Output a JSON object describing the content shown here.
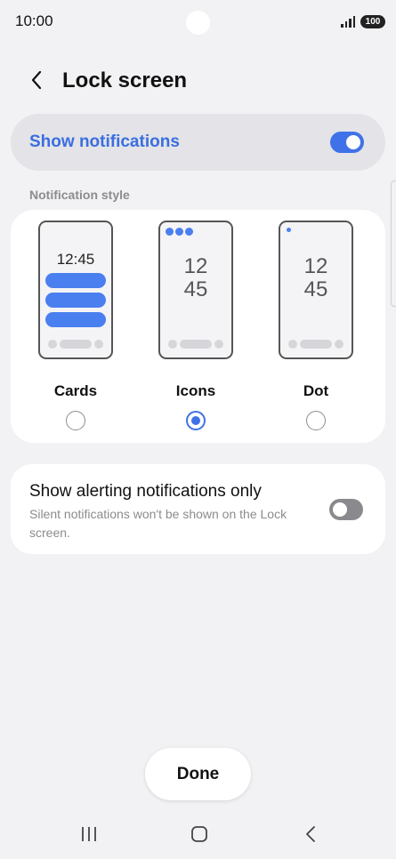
{
  "status_bar": {
    "time": "10:00",
    "battery": "100"
  },
  "header": {
    "title": "Lock screen",
    "back_icon": "chevron-left-icon"
  },
  "master": {
    "label": "Show notifications",
    "toggle_on": true
  },
  "section": {
    "label": "Notification style"
  },
  "styles": {
    "cards": {
      "label": "Cards",
      "preview_time": "12:45",
      "selected": false
    },
    "icons": {
      "label": "Icons",
      "preview_hour": "12",
      "preview_min": "45",
      "selected": true
    },
    "dot": {
      "label": "Dot",
      "preview_hour": "12",
      "preview_min": "45",
      "selected": false
    }
  },
  "alerting": {
    "title": "Show alerting notifications only",
    "subtitle": "Silent notifications won't be shown on the Lock screen.",
    "toggle_on": false
  },
  "done_label": "Done",
  "nav": {
    "recents_icon": "recents-icon",
    "home_icon": "home-icon",
    "back_icon": "back-icon"
  },
  "colors": {
    "accent": "#3f72e8",
    "background": "#f2f2f4",
    "card": "#ffffff"
  }
}
